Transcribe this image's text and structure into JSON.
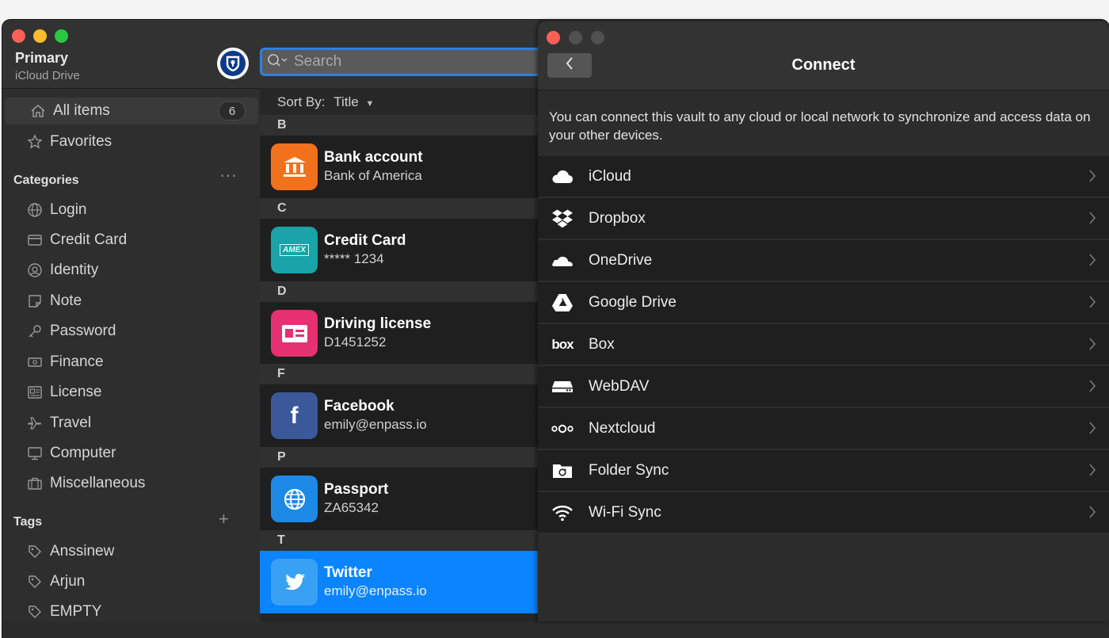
{
  "main_window": {
    "vault": {
      "name": "Primary",
      "location": "iCloud Drive"
    },
    "search": {
      "placeholder": "Search"
    },
    "sidebar": {
      "all_items": {
        "label": "All items",
        "count": "6"
      },
      "favorites": {
        "label": "Favorites"
      },
      "categories_title": "Categories",
      "categories": [
        {
          "label": "Login",
          "icon": "globe-icon"
        },
        {
          "label": "Credit Card",
          "icon": "credit-card-icon"
        },
        {
          "label": "Identity",
          "icon": "identity-icon"
        },
        {
          "label": "Note",
          "icon": "note-icon"
        },
        {
          "label": "Password",
          "icon": "key-icon"
        },
        {
          "label": "Finance",
          "icon": "banknote-icon"
        },
        {
          "label": "License",
          "icon": "license-icon"
        },
        {
          "label": "Travel",
          "icon": "airplane-icon"
        },
        {
          "label": "Computer",
          "icon": "monitor-icon"
        },
        {
          "label": "Miscellaneous",
          "icon": "briefcase-icon"
        }
      ],
      "tags_title": "Tags",
      "tags": [
        {
          "label": "Anssinew"
        },
        {
          "label": "Arjun"
        },
        {
          "label": "EMPTY"
        }
      ]
    },
    "list": {
      "sort_label": "Sort By:",
      "sort_value": "Title",
      "letters": [
        "B",
        "C",
        "D",
        "F",
        "P",
        "T"
      ],
      "items": [
        {
          "title": "Bank account",
          "subtitle": "Bank of America",
          "icon": "bank-icon",
          "color": "#f2711c"
        },
        {
          "title": "Credit Card",
          "subtitle": "***** 1234",
          "icon": "amex-card-icon",
          "color": "#1aa3a8",
          "icon_text": "AMEX"
        },
        {
          "title": "Driving license",
          "subtitle": "D1451252",
          "icon": "id-card-icon",
          "color": "#e5316f"
        },
        {
          "title": "Facebook",
          "subtitle": "emily@enpass.io",
          "icon": "facebook-icon",
          "color": "#3b5998",
          "icon_text": "f"
        },
        {
          "title": "Passport",
          "subtitle": "ZA65342",
          "icon": "globe-icon",
          "color": "#1e88e5"
        },
        {
          "title": "Twitter",
          "subtitle": "emily@enpass.io",
          "icon": "twitter-icon",
          "color": "#38a1f3"
        }
      ]
    }
  },
  "connect": {
    "title": "Connect",
    "description": "You can connect this vault to any cloud or local network to synchronize and access data on your other devices.",
    "services": [
      {
        "label": "iCloud",
        "icon": "icloud-icon"
      },
      {
        "label": "Dropbox",
        "icon": "dropbox-icon"
      },
      {
        "label": "OneDrive",
        "icon": "onedrive-icon"
      },
      {
        "label": "Google Drive",
        "icon": "google-drive-icon"
      },
      {
        "label": "Box",
        "icon": "box-icon",
        "icon_text": "box"
      },
      {
        "label": "WebDAV",
        "icon": "webdav-icon"
      },
      {
        "label": "Nextcloud",
        "icon": "nextcloud-icon"
      },
      {
        "label": "Folder Sync",
        "icon": "folder-sync-icon"
      },
      {
        "label": "Wi-Fi Sync",
        "icon": "wifi-icon"
      }
    ]
  }
}
